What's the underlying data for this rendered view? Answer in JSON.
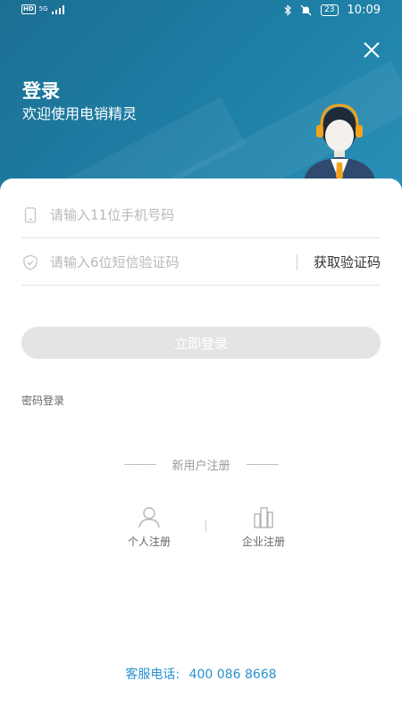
{
  "status_bar": {
    "network_badge": "HD",
    "signal_label": "5G",
    "battery_level": "23",
    "time": "10:09"
  },
  "header": {
    "title": "登录",
    "subtitle": "欢迎使用电销精灵"
  },
  "form": {
    "phone_placeholder": "请输入11位手机号码",
    "code_placeholder": "请输入6位短信验证码",
    "get_code_label": "获取验证码",
    "submit_label": "立即登录",
    "password_login_label": "密码登录"
  },
  "register": {
    "title": "新用户注册",
    "left_dashes": "———",
    "right_dashes": "———",
    "personal_label": "个人注册",
    "enterprise_label": "企业注册"
  },
  "hotline": {
    "label": "客服电话:",
    "number": "400 086 8668"
  },
  "colors": {
    "header_bg": "#1e7fa6",
    "accent": "#2b8fcf",
    "button_disabled": "#e4e4e4"
  },
  "icons": [
    "phone-icon",
    "shield-icon",
    "close-icon",
    "user-icon",
    "building-icon",
    "customer-service-avatar"
  ]
}
